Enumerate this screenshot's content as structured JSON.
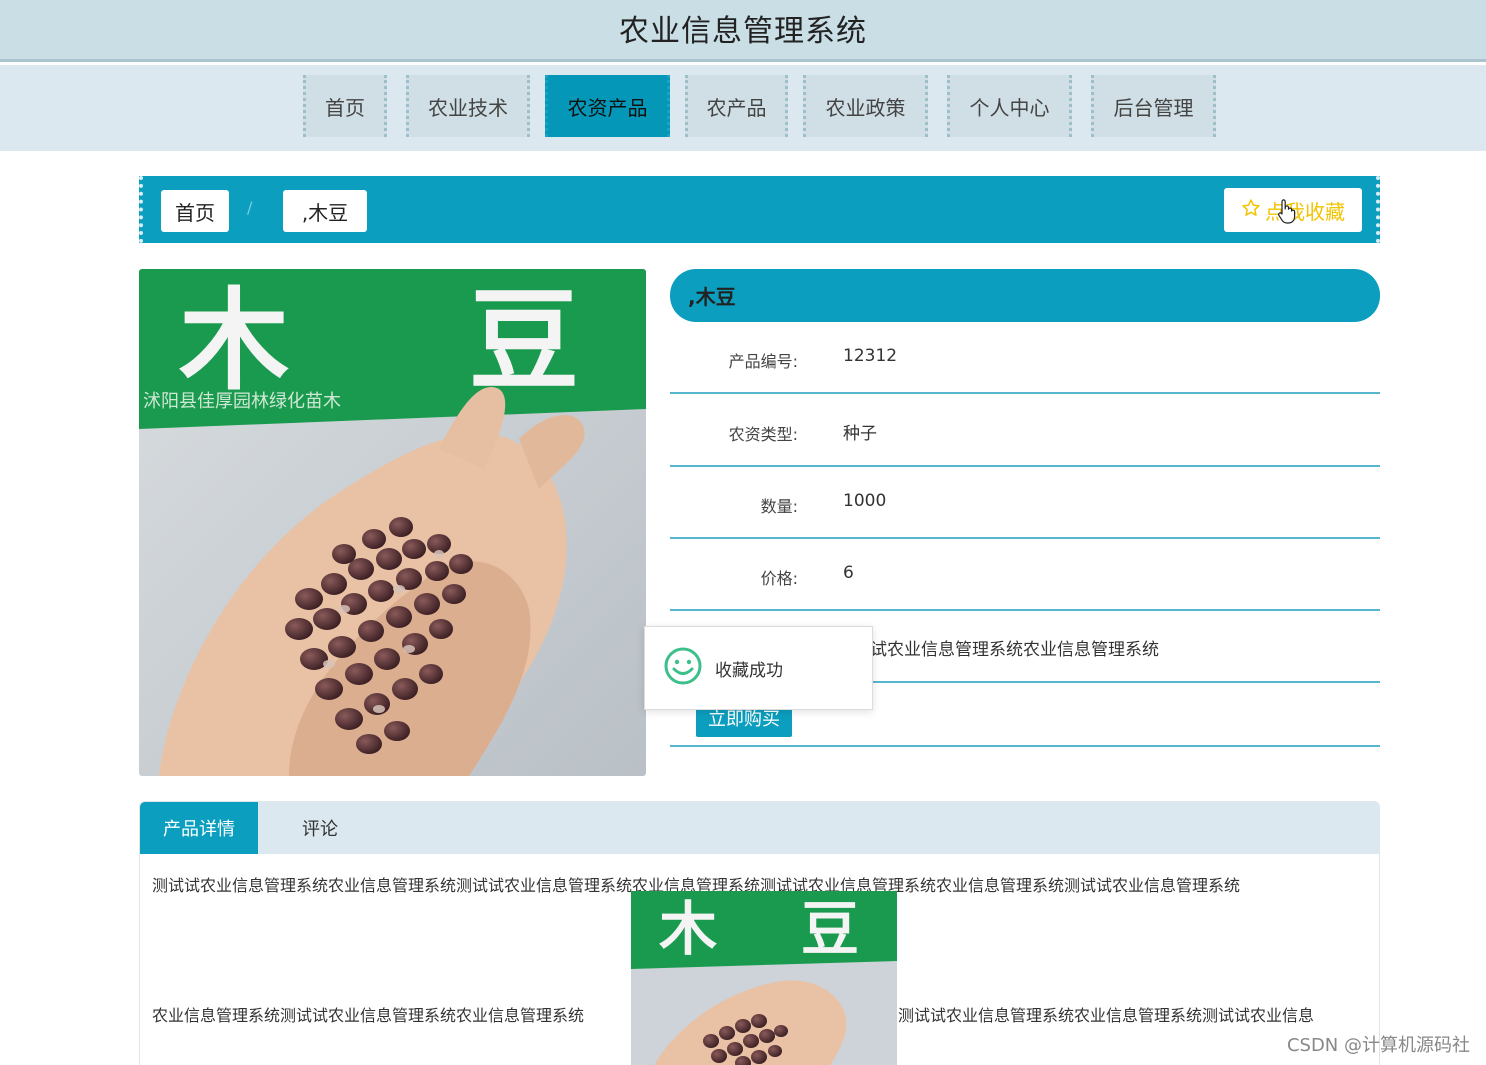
{
  "site": {
    "title": "农业信息管理系统"
  },
  "nav": {
    "items": [
      {
        "label": "首页"
      },
      {
        "label": "农业技术"
      },
      {
        "label": "农资产品",
        "active": true
      },
      {
        "label": "农产品"
      },
      {
        "label": "农业政策"
      },
      {
        "label": "个人中心"
      },
      {
        "label": "后台管理"
      }
    ]
  },
  "breadcrumb": {
    "home": "首页",
    "separator": "/",
    "current": ",木豆",
    "favorite_label": "点我收藏"
  },
  "product": {
    "title": ",木豆",
    "fields": [
      {
        "label": "产品编号:",
        "value": "12312"
      },
      {
        "label": "农资类型:",
        "value": "种子"
      },
      {
        "label": "数量:",
        "value": "1000"
      },
      {
        "label": "价格:",
        "value": "6"
      },
      {
        "label": "",
        "value": "试农业信息管理系统农业信息管理系统"
      }
    ],
    "buy_label": "立即购买"
  },
  "toast": {
    "message": "收藏成功"
  },
  "tabs": {
    "items": [
      {
        "label": "产品详情",
        "active": true
      },
      {
        "label": "评论"
      }
    ],
    "detail_line_1": "测试试农业信息管理系统农业信息管理系统测试试农业信息管理系统农业信息管理系统测试试农业信息管理系统农业信息管理系统测试试农业信息管理系统",
    "detail_line_2_left": "农业信息管理系统测试试农业信息管理系统农业信息管理系统",
    "detail_line_2_right": "测试试农业信息管理系统农业信息管理系统测试试农业信息"
  },
  "image_text": {
    "char_1": "木",
    "char_2": "豆",
    "banner": "沭阳县佳厚园林绿化苗木"
  },
  "watermark": "CSDN @计算机源码社",
  "colors": {
    "primary": "#0b9ebe",
    "header_bg": "#c9dee5",
    "nav_bg": "#dbe8ef",
    "favorite": "#f2c300"
  }
}
